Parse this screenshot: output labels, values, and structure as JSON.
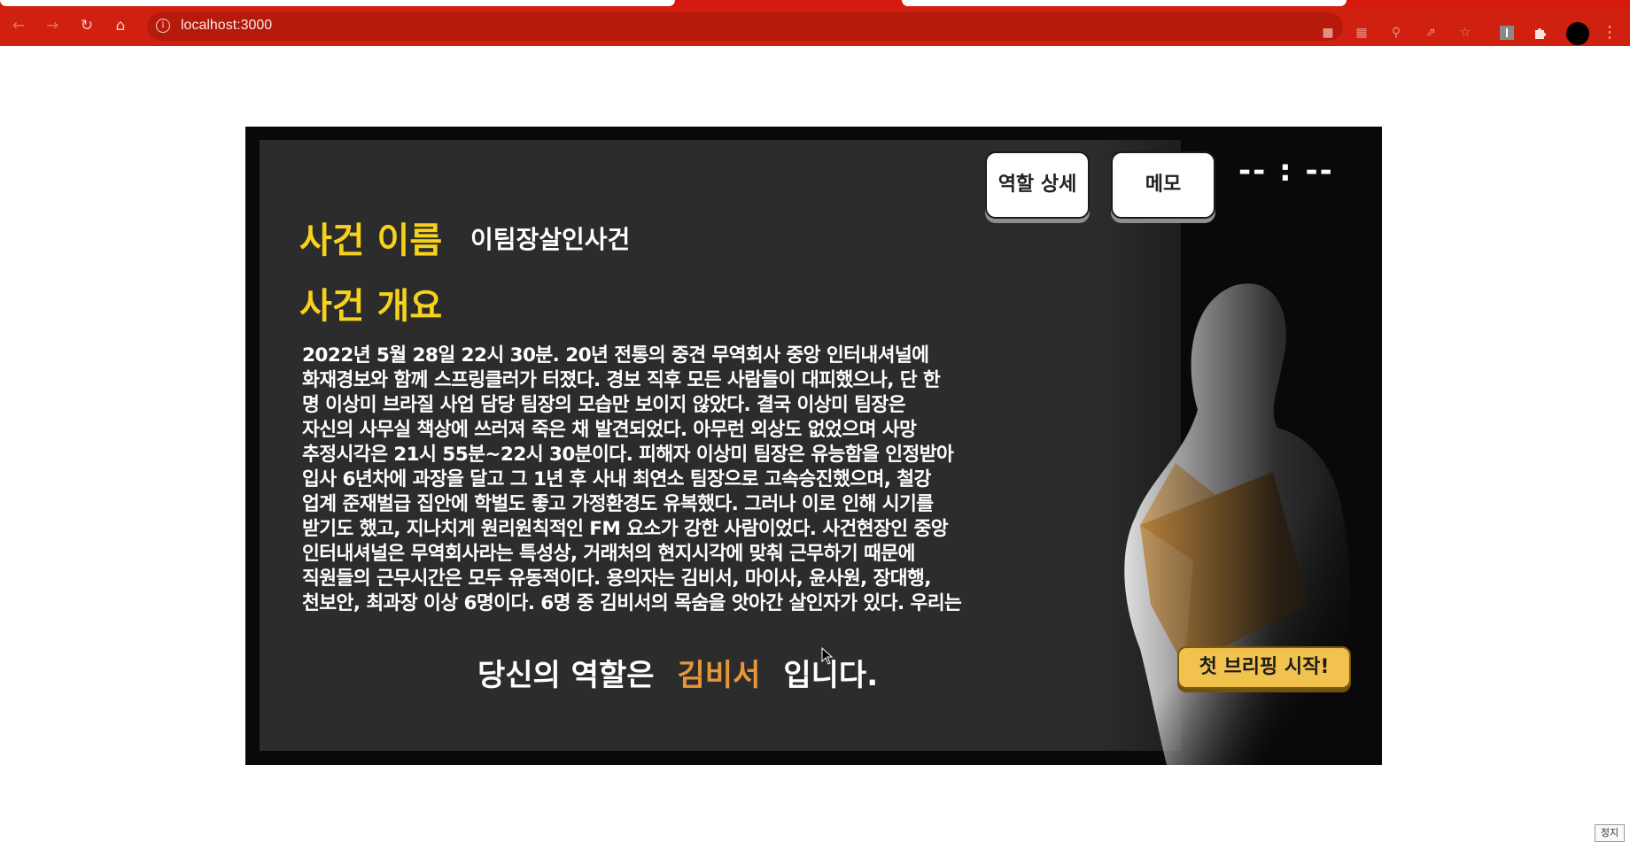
{
  "browser": {
    "url": "localhost:3000",
    "toolbar_icons": [
      "back-icon",
      "forward-icon",
      "reload-icon",
      "home-icon",
      "site-info-icon",
      "camera-icon",
      "translate-icon",
      "zoom-icon",
      "share-icon",
      "bookmark-star-icon",
      "extension-icon",
      "puzzle-icon",
      "profile-avatar",
      "menu-icon"
    ]
  },
  "game": {
    "buttons": {
      "role_detail": "역할 상세",
      "memo": "메모",
      "start_briefing": "첫 브리핑 시작!"
    },
    "timer": "-- : --",
    "case_name_label": "사건 이름",
    "case_name_value": "이팀장살인사건",
    "summary_label": "사건 개요",
    "summary_text": "2022년 5월 28일 22시 30분. 20년 전통의 중견 무역회사 중앙 인터내셔널에\n화재경보와 함께 스프링클러가 터졌다. 경보 직후 모든 사람들이 대피했으나, 단 한\n명 이상미 브라질 사업 담당 팀장의 모습만 보이지 않았다. 결국 이상미 팀장은\n자신의 사무실 책상에 쓰러져 죽은 채 발견되었다. 아무런 외상도 없었으며 사망\n추정시각은 21시 55분~22시 30분이다. 피해자 이상미 팀장은 유능함을 인정받아\n입사 6년차에 과장을 달고 그 1년 후 사내 최연소 팀장으로 고속승진했으며, 철강\n업계 준재벌급 집안에 학벌도 좋고 가정환경도 유복했다. 그러나 이로 인해 시기를\n받기도 했고, 지나치게 원리원칙적인 FM 요소가 강한 사람이었다. 사건현장인 중앙\n인터내셔널은 무역회사라는 특성상, 거래처의 현지시각에 맞춰 근무하기 때문에\n직원들의 근무시간은 모두 유동적이다. 용의자는 김비서, 마이사, 윤사원, 장대행,\n천보안, 최과장 이상 6명이다. 6명 중 김비서의 목숨을 앗아간 살인자가 있다. 우리는",
    "role_prefix": "당신의 역할은",
    "role_name": "김비서",
    "role_suffix": "입니다.",
    "colors": {
      "accent_yellow": "#f7d21b",
      "role_orange": "#e8963a",
      "start_button": "#f2c24e",
      "board": "#2c2c2c",
      "browser_red": "#d0200f"
    }
  },
  "overlay": {
    "stop_label": "정지"
  }
}
